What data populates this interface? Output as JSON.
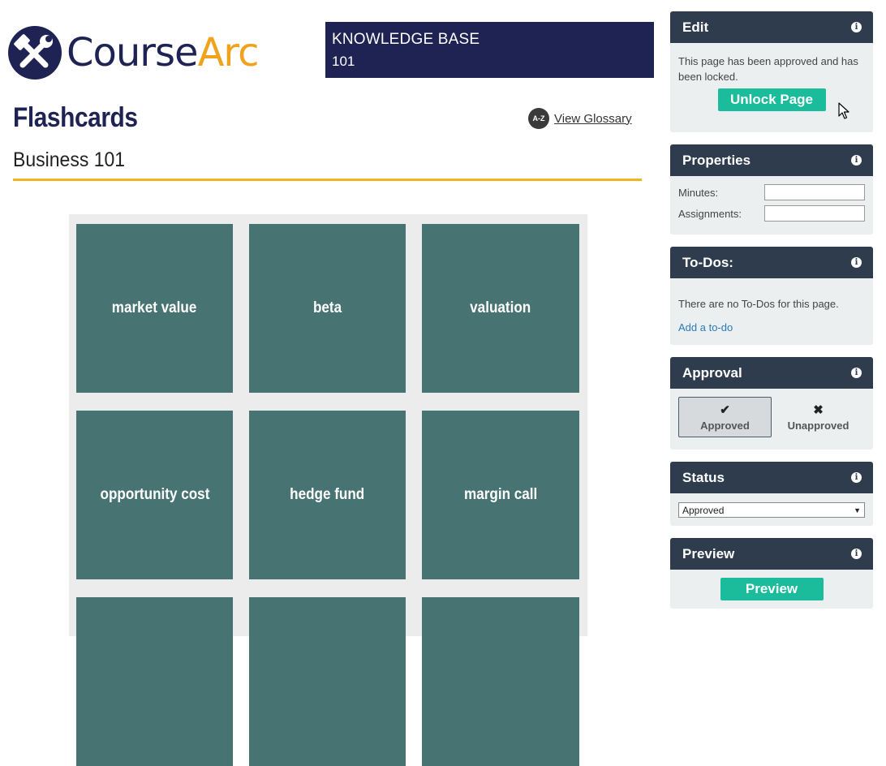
{
  "brand": {
    "logo_part1": "Course",
    "logo_part2": "Arc",
    "primary_color": "#1f2354",
    "accent_color": "#f0a21c",
    "logo_icon": "tools-icon"
  },
  "course_box": {
    "line1": "KNOWLEDGE BASE",
    "line2": "101"
  },
  "page": {
    "title": "Flashcards",
    "subtitle": "Business 101",
    "glossary_icon": "A-Z",
    "glossary_link": "View Glossary"
  },
  "flashcards": [
    {
      "term": "market value"
    },
    {
      "term": "beta"
    },
    {
      "term": "valuation"
    },
    {
      "term": "opportunity cost"
    },
    {
      "term": "hedge fund"
    },
    {
      "term": "margin call"
    },
    {
      "term": ""
    },
    {
      "term": ""
    },
    {
      "term": ""
    }
  ],
  "card_color": "#477472",
  "sidebar": {
    "edit": {
      "title": "Edit",
      "message": "This page has been approved and has been locked.",
      "button": "Unlock Page"
    },
    "properties": {
      "title": "Properties",
      "minutes_label": "Minutes:",
      "minutes_value": "",
      "assignments_label": "Assignments:",
      "assignments_value": ""
    },
    "todos": {
      "title": "To-Dos:",
      "message": "There are no To-Dos for this page.",
      "add_link": "Add a to-do"
    },
    "approval": {
      "title": "Approval",
      "approved_label": "Approved",
      "approved_glyph": "✔",
      "unapproved_label": "Unapproved",
      "unapproved_glyph": "✖",
      "selected": "Approved"
    },
    "status": {
      "title": "Status",
      "selected": "Approved",
      "arrow": "▼"
    },
    "preview": {
      "title": "Preview",
      "button": "Preview"
    },
    "info_glyph": "i",
    "header_color": "#2e3c4e",
    "button_color": "#1abc9c"
  }
}
